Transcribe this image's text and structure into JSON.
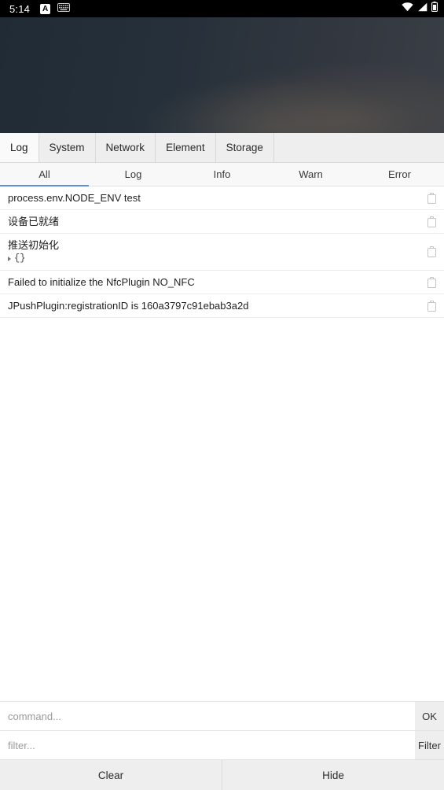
{
  "status_bar": {
    "time": "5:14",
    "badge_label": "A",
    "icons": [
      "notification-badge-a-icon",
      "keyboard-icon",
      "wifi-icon",
      "cellular-signal-icon",
      "battery-icon"
    ]
  },
  "tabs": {
    "items": [
      {
        "label": "Log",
        "active": true
      },
      {
        "label": "System",
        "active": false
      },
      {
        "label": "Network",
        "active": false
      },
      {
        "label": "Element",
        "active": false
      },
      {
        "label": "Storage",
        "active": false
      }
    ]
  },
  "levels": {
    "items": [
      {
        "label": "All",
        "active": true
      },
      {
        "label": "Log",
        "active": false
      },
      {
        "label": "Info",
        "active": false
      },
      {
        "label": "Warn",
        "active": false
      },
      {
        "label": "Error",
        "active": false
      }
    ],
    "active_underline_color": "#5b93cf"
  },
  "log_list": {
    "copy_icon": "clipboard-copy-icon",
    "entries": [
      {
        "text": "process.env.NODE_ENV test",
        "object": null
      },
      {
        "text": "设备已就绪",
        "object": null
      },
      {
        "text": "推送初始化",
        "object": "{}"
      },
      {
        "text": "Failed to initialize the NfcPlugin NO_NFC",
        "object": null
      },
      {
        "text": "JPushPlugin:registrationID is 160a3797c91ebab3a2d",
        "object": null
      }
    ]
  },
  "console": {
    "command_placeholder": "command...",
    "command_value": "",
    "ok_label": "OK",
    "filter_placeholder": "filter...",
    "filter_value": "",
    "filter_label": "Filter",
    "clear_label": "Clear",
    "hide_label": "Hide"
  }
}
